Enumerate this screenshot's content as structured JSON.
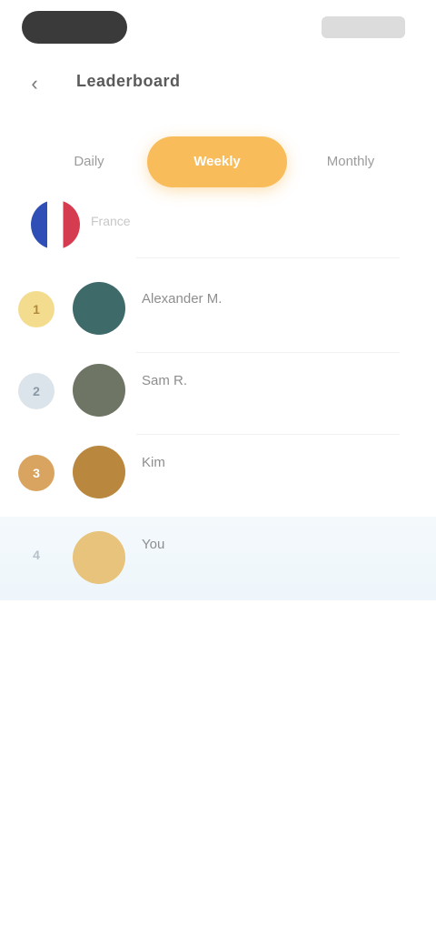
{
  "colors": {
    "accent": "#f9bc5a",
    "highlight_row": "#eef6fb"
  },
  "header": {
    "back_icon": "chevron-left-icon",
    "title": "Leaderboard"
  },
  "tabs": [
    {
      "label": "Daily"
    },
    {
      "label": "Weekly"
    },
    {
      "label": "Monthly"
    }
  ],
  "region": {
    "flag_icon": "flag-icon",
    "label": "France"
  },
  "rows": [
    {
      "rank": "1",
      "name": "Alexander M.",
      "sub": "",
      "avatar_color": "#3f6a6a"
    },
    {
      "rank": "2",
      "name": "Sam R.",
      "sub": "",
      "avatar_color": "#6e7565"
    },
    {
      "rank": "3",
      "name": "Kim",
      "sub": "",
      "avatar_color": "#b9873e"
    },
    {
      "rank": "4",
      "name": "You",
      "sub": "",
      "avatar_color": "#e7c37b",
      "is_me": true
    }
  ]
}
